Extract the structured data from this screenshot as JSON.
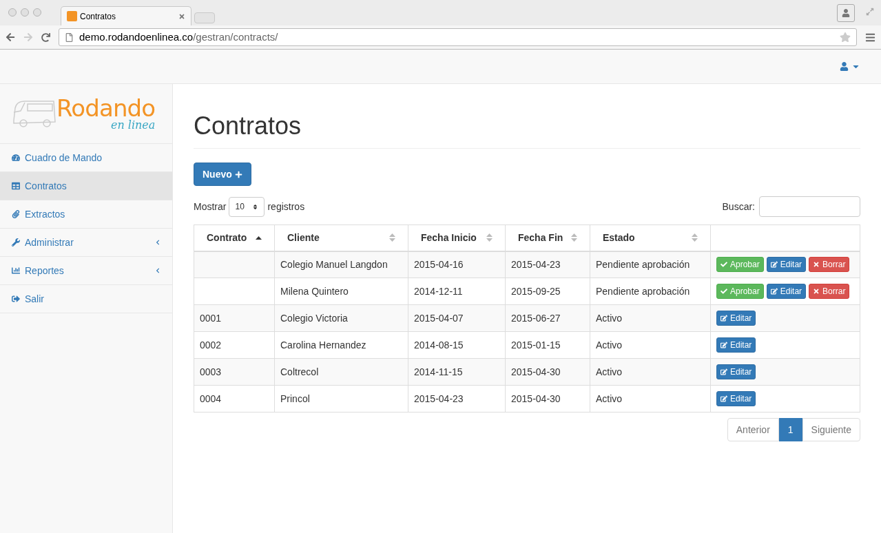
{
  "browser": {
    "tab_title": "Contratos",
    "url_host": "demo.rodandoenlinea.co",
    "url_path": "/gestran/contracts/"
  },
  "logo": {
    "title": "Rodando",
    "subtitle": "en linea"
  },
  "sidebar": {
    "items": [
      {
        "label": "Cuadro de Mando",
        "selected": false,
        "submenu": false
      },
      {
        "label": "Contratos",
        "selected": true,
        "submenu": false
      },
      {
        "label": "Extractos",
        "selected": false,
        "submenu": false
      },
      {
        "label": "Administrar",
        "selected": false,
        "submenu": true
      },
      {
        "label": "Reportes",
        "selected": false,
        "submenu": true
      },
      {
        "label": "Salir",
        "selected": false,
        "submenu": false
      }
    ]
  },
  "page": {
    "title": "Contratos",
    "new_button": "Nuevo",
    "show_label": "Mostrar",
    "page_size": "10",
    "records_label": "registros",
    "search_label": "Buscar:"
  },
  "table": {
    "columns": [
      {
        "label": "Contrato",
        "sorted": true
      },
      {
        "label": "Cliente",
        "sorted": false
      },
      {
        "label": "Fecha Inicio",
        "sorted": false
      },
      {
        "label": "Fecha Fin",
        "sorted": false
      },
      {
        "label": "Estado",
        "sorted": false
      }
    ],
    "rows": [
      {
        "cells": [
          "",
          "Colegio Manuel Langdon",
          "2015-04-16",
          "2015-04-23",
          "Pendiente aprobación"
        ],
        "actions": [
          {
            "kind": "approve",
            "label": "Aprobar"
          },
          {
            "kind": "edit",
            "label": "Editar"
          },
          {
            "kind": "delete",
            "label": "Borrar"
          }
        ]
      },
      {
        "cells": [
          "",
          "Milena Quintero",
          "2014-12-11",
          "2015-09-25",
          "Pendiente aprobación"
        ],
        "actions": [
          {
            "kind": "approve",
            "label": "Aprobar"
          },
          {
            "kind": "edit",
            "label": "Editar"
          },
          {
            "kind": "delete",
            "label": "Borrar"
          }
        ]
      },
      {
        "cells": [
          "0001",
          "Colegio Victoria",
          "2015-04-07",
          "2015-06-27",
          "Activo"
        ],
        "actions": [
          {
            "kind": "edit",
            "label": "Editar"
          }
        ]
      },
      {
        "cells": [
          "0002",
          "Carolina Hernandez",
          "2014-08-15",
          "2015-01-15",
          "Activo"
        ],
        "actions": [
          {
            "kind": "edit",
            "label": "Editar"
          }
        ]
      },
      {
        "cells": [
          "0003",
          "Coltrecol",
          "2014-11-15",
          "2015-04-30",
          "Activo"
        ],
        "actions": [
          {
            "kind": "edit",
            "label": "Editar"
          }
        ]
      },
      {
        "cells": [
          "0004",
          "Princol",
          "2015-04-23",
          "2015-04-30",
          "Activo"
        ],
        "actions": [
          {
            "kind": "edit",
            "label": "Editar"
          }
        ]
      }
    ]
  },
  "pagination": {
    "previous": "Anterior",
    "next": "Siguiente",
    "pages": [
      {
        "label": "1",
        "selected": true
      }
    ]
  }
}
